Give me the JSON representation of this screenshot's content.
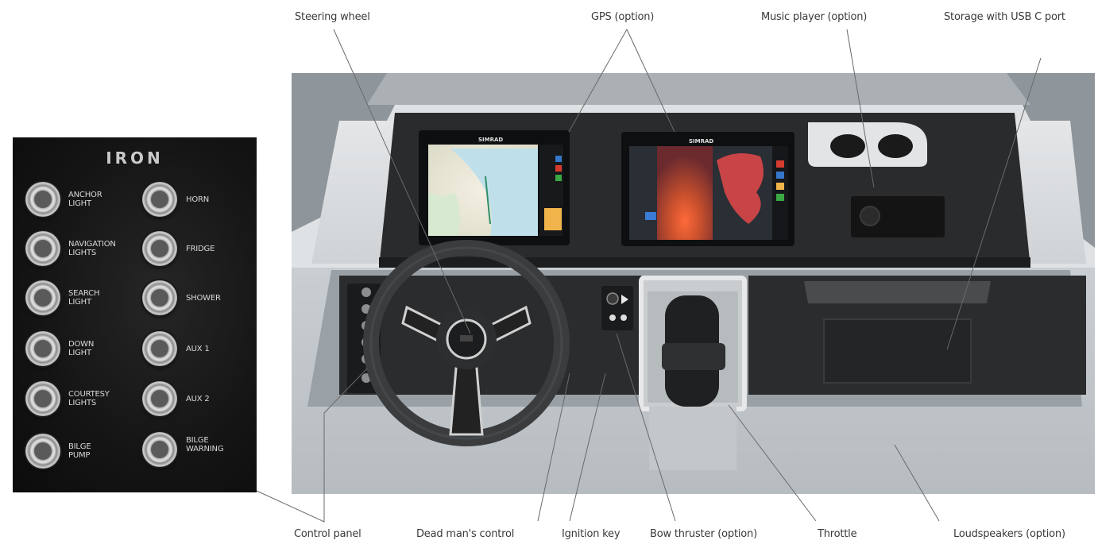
{
  "labels": {
    "steering_wheel": "Steering wheel",
    "gps": "GPS (option)",
    "music_player": "Music player (option)",
    "storage": "Storage with USB C port",
    "control_panel": "Control panel",
    "dead_mans_control": "Dead man's control",
    "ignition_key": "Ignition key",
    "bow_thruster": "Bow thruster (option)",
    "throttle": "Throttle",
    "loudspeakers": "Loudspeakers (option)"
  },
  "switch_panel": {
    "brand": "IRON",
    "switches_left": [
      "ANCHOR\nLIGHT",
      "NAVIGATION\nLIGHTS",
      "SEARCH\nLIGHT",
      "DOWN\nLIGHT",
      "COURTESY\nLIGHTS",
      "BILGE\nPUMP"
    ],
    "switches_right": [
      "HORN",
      "FRIDGE",
      "SHOWER",
      "AUX 1",
      "AUX 2",
      "BILGE\nWARNING"
    ]
  },
  "screens": {
    "left_brand": "SIMRAD",
    "right_brand": "SIMRAD"
  }
}
